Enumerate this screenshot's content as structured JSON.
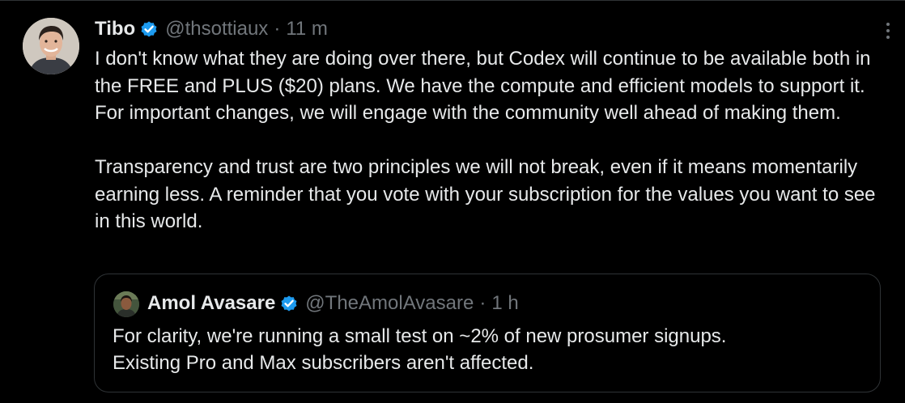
{
  "colors": {
    "background": "#000000",
    "text": "#e7e9ea",
    "secondary": "#71767b",
    "verified_blue": "#1d9bf0",
    "border": "#2f3336"
  },
  "tweet": {
    "author": {
      "name": "Tibo",
      "handle": "@thsottiaux",
      "verified": true,
      "avatar_icon": "profile-photo"
    },
    "separator": "·",
    "time": "11 m",
    "paragraphs": [
      "I don't know what they are doing over there, but Codex will continue to be available both in the FREE and PLUS ($20) plans. We have the compute and efficient models to support it. For important changes, we will engage with the community well ahead of making them.",
      "Transparency and trust are two principles we will not break, even if it means momentarily earning less. A reminder that you vote with your subscription for the values you want to see in this world."
    ],
    "more_icon": "more-vertical-icon"
  },
  "quoted_tweet": {
    "author": {
      "name": "Amol Avasare",
      "handle": "@TheAmolAvasare",
      "verified": true
    },
    "separator": "·",
    "time": "1 h",
    "text": "For clarity, we're running a small test on ~2% of new prosumer signups.\nExisting Pro and Max subscribers aren't affected."
  }
}
